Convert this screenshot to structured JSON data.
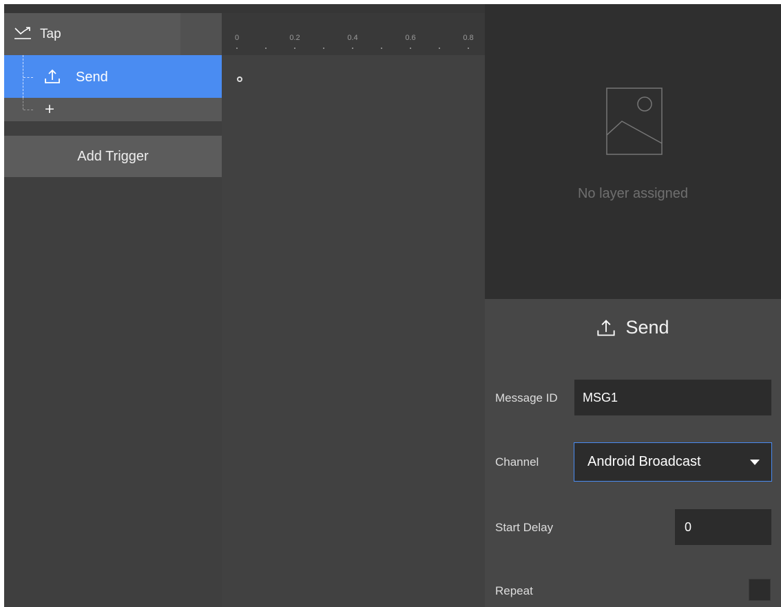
{
  "trigger": {
    "label": "Tap",
    "icon": "swipe-trigger-icon"
  },
  "action": {
    "label": "Send",
    "icon": "send-upload-icon"
  },
  "add_action": {
    "label": "+"
  },
  "add_trigger_button": {
    "label": "Add Trigger"
  },
  "timeline": {
    "ticks": [
      "0",
      "0.2",
      "0.4",
      "0.6",
      "0.8"
    ]
  },
  "preview": {
    "empty_text": "No layer assigned",
    "icon": "image-placeholder-icon"
  },
  "inspector": {
    "title": "Send",
    "message_id": {
      "label": "Message ID",
      "value": "MSG1"
    },
    "channel": {
      "label": "Channel",
      "value": "Android Broadcast"
    },
    "start_delay": {
      "label": "Start Delay",
      "value": "0"
    },
    "repeat": {
      "label": "Repeat",
      "checked": false
    }
  },
  "colors": {
    "accent": "#4a8cf2",
    "panel": "#3f3f3f",
    "preview_bg": "#2f2f2f",
    "input_bg": "#2c2c2c"
  }
}
